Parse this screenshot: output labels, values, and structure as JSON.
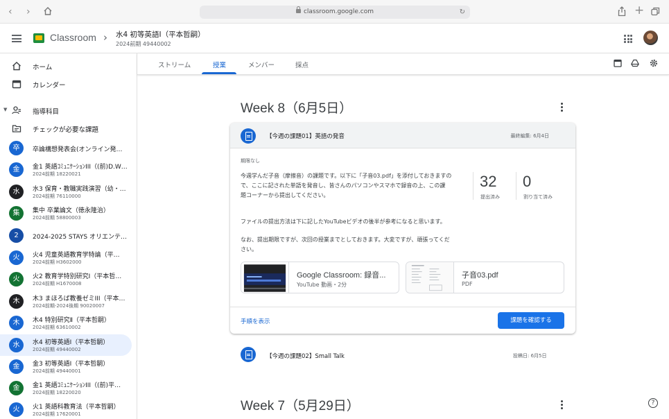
{
  "browser": {
    "url": "classroom.google.com"
  },
  "header": {
    "app_name": "Classroom",
    "course_title": "水4 初等英語Ⅰ（平本哲嗣）",
    "course_subtitle": "2024前期 49440002"
  },
  "sidebar": {
    "home": "ホーム",
    "calendar": "カレンダー",
    "teaching_section": "指導科目",
    "to_review": "チェックが必要な課題",
    "courses": [
      {
        "initial": "卒",
        "name": "卒論構想発表会(オンライン発…",
        "sub": "",
        "color": "#1967d2"
      },
      {
        "initial": "金",
        "name": "金1 英語ｺﾐｭﾆｹｰｼｮﾝIII（(前)D.W…",
        "sub": "2024前期 18220021",
        "color": "#1967d2"
      },
      {
        "initial": "水",
        "name": "水3 保育・教職実践演習（幼・…",
        "sub": "2024前期 76110000",
        "color": "#202124"
      },
      {
        "initial": "集",
        "name": "集中 卒業論文（徳永隆治）",
        "sub": "2024前期 58800003",
        "color": "#137333"
      },
      {
        "initial": "2",
        "name": "2024-2025 STAYS オリエンテ…",
        "sub": "",
        "color": "#174ea6"
      },
      {
        "initial": "火",
        "name": "火4 児童英語教育学特論（平…",
        "sub": "2024前期 H3602000",
        "color": "#1967d2"
      },
      {
        "initial": "火",
        "name": "火2 教育学特別研究Ⅰ（平本哲…",
        "sub": "2024前期 H1670008",
        "color": "#137333"
      },
      {
        "initial": "木",
        "name": "木3 まほろば教養ゼミIII（平本…",
        "sub": "2024前期-2024後期 90020007",
        "color": "#202124"
      },
      {
        "initial": "木",
        "name": "木4 特別研究Ⅱ（平本哲嗣）",
        "sub": "2024前期 63610002",
        "color": "#1967d2"
      },
      {
        "initial": "水",
        "name": "水4 初等英語Ⅰ（平本哲嗣）",
        "sub": "2024前期 49440002",
        "color": "#1967d2"
      },
      {
        "initial": "金",
        "name": "金3 初等英語Ⅰ（平本哲嗣）",
        "sub": "2024前期 49440001",
        "color": "#1967d2"
      },
      {
        "initial": "金",
        "name": "金1 英語ｺﾐｭﾆｹｰｼｮﾝIII（(前)平…",
        "sub": "2024前期 18220020",
        "color": "#137333"
      },
      {
        "initial": "火",
        "name": "火1 英語科教育法（平本哲嗣）",
        "sub": "2024前期 17620001",
        "color": "#1967d2"
      }
    ]
  },
  "tabs": [
    "ストリーム",
    "授業",
    "メンバー",
    "採点"
  ],
  "main": {
    "week8_title": "Week 8（6月5日）",
    "week7_title": "Week 7（5月29日）",
    "card1": {
      "title": "【今週の課題01】英語の発音",
      "edited": "最終編集: 6月4日",
      "due": "期限なし",
      "body_line1": "今週学んだ子音（摩擦音）の課題です。以下に「子音03.pdf」を添付しておきますの",
      "body_line2": "で、ここに記された単語を発音し、皆さんのパソコンやスマホで録音の上、この課",
      "body_line3": "題コーナーから提出してください。",
      "body_line4": "ファイルの提出方法は下に記したYouTubeビデオの後半が参考になると思います。",
      "body_line5": "なお、提出期限ですが、次回の授業までとしておきます。大変ですが、頑張ってくだ",
      "body_line6": "さい。",
      "submitted_count": "32",
      "submitted_label": "提出済み",
      "assigned_count": "0",
      "assigned_label": "割り当て済み",
      "attachment1_title": "Google Classroom: 録音...",
      "attachment1_sub": "YouTube 動画・2分",
      "attachment2_title": "子音03.pdf",
      "attachment2_sub": "PDF",
      "show_steps": "手順を表示",
      "check_button": "課題を確認する"
    },
    "card2": {
      "title": "【今週の課題02】Small Talk",
      "date": "投稿日: 6月5日"
    },
    "help": "?"
  }
}
